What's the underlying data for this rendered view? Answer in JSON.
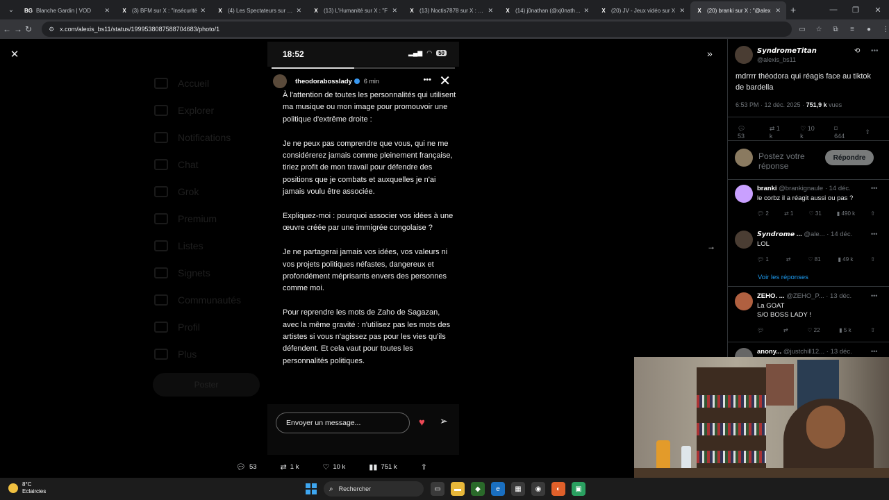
{
  "browser": {
    "tabs": [
      {
        "label": "Blanche Gardin | VOD",
        "favicon": "BG"
      },
      {
        "label": "(3) BFM sur X : \"Insécurité",
        "favicon": "X"
      },
      {
        "label": "(4) Les Spectateurs sur X :",
        "favicon": "X"
      },
      {
        "label": "(13) L'Humanité sur X : \"F",
        "favicon": "X"
      },
      {
        "label": "(13) Noctis7878 sur X : \"@",
        "favicon": "X"
      },
      {
        "label": "(14) j0nathan (@xj0nathan",
        "favicon": "X"
      },
      {
        "label": "(20) JV - Jeux vidéo sur X",
        "favicon": "X"
      },
      {
        "label": "(20) branki sur X : \"@alex",
        "favicon": "X"
      }
    ],
    "url": "x.com/alexis_bs11/status/1999538087588704683/photo/1",
    "window_controls": [
      "—",
      "❐",
      "✕"
    ]
  },
  "background_nav": {
    "items": [
      "Accueil",
      "Explorer",
      "Notifications",
      "Chat",
      "Grok",
      "Premium",
      "Listes",
      "Signets",
      "Communautés",
      "Profil",
      "Plus"
    ],
    "post_button": "Poster"
  },
  "phone": {
    "time": "18:52",
    "battery": "50",
    "username": "theodorabosslady",
    "time_ago": "6 min",
    "paragraphs": [
      "À l'attention de toutes les personnalités qui utilisent ma musique ou mon image pour promouvoir une politique d'extrême droite :",
      "Je ne peux pas comprendre que vous, qui ne me considérerez jamais comme pleinement française, tiriez profit de mon travail pour défendre des positions que je combats et auxquelles je n'ai jamais voulu être associée.",
      "Expliquez-moi : pourquoi associer vos idées à une œuvre créée par une immigrée congolaise ?",
      "Je ne partagerai jamais vos idées, vos valeurs ni vos projets politiques néfastes, dangereux et profondément méprisants envers des personnes comme moi.",
      "Pour reprendre les mots de Zaho de Sagazan, avec la même gravité : n'utilisez pas les mots des artistes si vous n'agissez pas pour les vies qu'ils défendent. Et cela vaut pour toutes les personnalités politiques."
    ],
    "message_placeholder": "Envoyer un message...",
    "story_progress": 0.45
  },
  "viewer_actions": {
    "replies": "53",
    "reposts": "1 k",
    "likes": "10 k",
    "views": "751 k"
  },
  "tweet": {
    "display_name": "𝙎𝙮𝙣𝙙𝙧𝙤𝙢𝙚𝙏𝙞𝙩𝙖𝙣",
    "handle": "@alexis_bs11",
    "text": "mdrrrr théodora qui réagis face au tiktok de bardella",
    "timestamp": "6:53 PM · 12 déc. 2025 · ",
    "views_value": "751,9 k",
    "views_label": " vues",
    "stats": {
      "replies": "53",
      "reposts": "1 k",
      "likes": "10 k",
      "bookmarks": "644"
    },
    "reply_placeholder": "Postez votre réponse",
    "reply_button": "Répondre"
  },
  "comments": [
    {
      "name": "branki",
      "handle": "@brankignaule",
      "date": "· 14 déc.",
      "text": "le corbz il a réagit aussi ou pas ?",
      "replies": "2",
      "reposts": "1",
      "likes": "31",
      "views": "490 k",
      "avatar_color": "#c9a0ff"
    },
    {
      "name": "𝙎𝙮𝙣𝙙𝙧𝙤𝙢𝙚 ...",
      "handle": "@ale...",
      "date": "· 14 déc.",
      "text": "LOL",
      "replies": "1",
      "reposts": "",
      "likes": "81",
      "views": "49 k",
      "avatar_color": "#4a3d33"
    },
    {
      "name": "ZEHO. ...",
      "handle": "@ZEHO_P...",
      "date": "· 13 déc.",
      "text": "La GOAT\nS/O BOSS LADY !",
      "replies": "",
      "reposts": "",
      "likes": "22",
      "views": "5 k",
      "avatar_color": "#b06040"
    },
    {
      "name": "anony...",
      "handle": "@justchill12...",
      "date": "· 13 déc.",
      "text": "",
      "replies": "",
      "reposts": "",
      "likes": "",
      "views": "",
      "avatar_color": "#666"
    }
  ],
  "show_replies": "Voir les réponses",
  "taskbar": {
    "temp": "8°C",
    "weather": "Eclaircies",
    "search": "Rechercher"
  }
}
